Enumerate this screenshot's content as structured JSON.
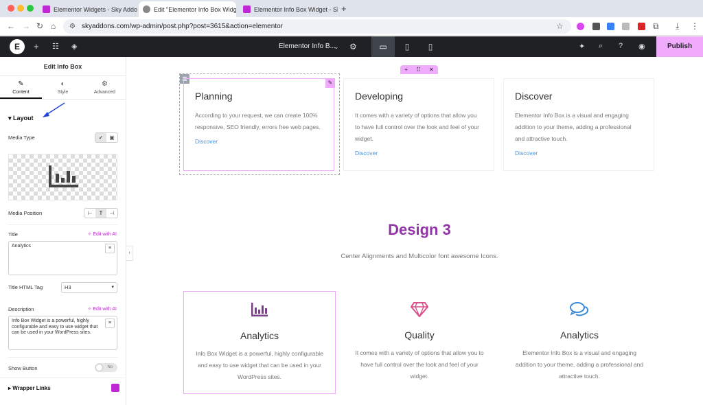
{
  "browser": {
    "tabs": [
      {
        "title": "Elementor Widgets - Sky Addons",
        "active": false
      },
      {
        "title": "Edit \"Elementor Info Box Widget\"",
        "active": true
      },
      {
        "title": "Elementor Info Box Widget - Sky",
        "active": false
      }
    ],
    "new_tab": "+",
    "url": "skyaddons.com/wp-admin/post.php?post=3615&action=elementor"
  },
  "editor_bar": {
    "page_title": "Elementor Info B...",
    "publish_label": "Publish"
  },
  "panel": {
    "title": "Edit Info Box",
    "tabs": [
      {
        "label": "Content",
        "icon": "pencil-icon",
        "glyph": "✎",
        "active": true
      },
      {
        "label": "Style",
        "icon": "half-circle-icon",
        "glyph": "◐",
        "active": false
      },
      {
        "label": "Advanced",
        "icon": "gear-icon",
        "glyph": "⚙",
        "active": false
      }
    ],
    "layout_heading": "Layout",
    "media_type_label": "Media Type",
    "media_position_label": "Media Position",
    "title_label": "Title",
    "edit_ai": "Edit with AI",
    "title_value": "Analytics",
    "title_tag_label": "Title HTML Tag",
    "title_tag_value": "H3",
    "description_label": "Description",
    "description_value": "Info Box Widget is a powerful, highly configurable and easy to use widget that can be used in your WordPress sites.",
    "show_button_label": "Show Button",
    "show_button_state": "No",
    "wrapper_links_heading": "Wrapper Links"
  },
  "canvas": {
    "cards_row1": [
      {
        "title": "Planning",
        "text": "According to your request, we can create 100% responsive, SEO friendly, errors free web pages.",
        "link": "Discover"
      },
      {
        "title": "Developing",
        "text": "It comes with a variety of options that allow you to have full control over the look and feel of your widget.",
        "link": "Discover"
      },
      {
        "title": "Discover",
        "text": "Elementor Info Box is a visual and engaging addition to your theme, adding a professional and attractive touch.",
        "link": "Discover"
      }
    ],
    "design_title": "Design 3",
    "design_subtitle": "Center Alignments and Multicolor font awesome Icons.",
    "cards_row2": [
      {
        "title": "Analytics",
        "text": "Info Box Widget is a powerful, highly configurable and easy to use widget that can be used in your WordPress sites.",
        "icon": "bar-chart-icon",
        "color": "#7b3f8c"
      },
      {
        "title": "Quality",
        "text": "It comes with a variety of options that allow you to have full control over the look and feel of your widget.",
        "icon": "diamond-icon",
        "color": "#d94f8a"
      },
      {
        "title": "Analytics",
        "text": "Elementor Info Box is a visual and engaging addition to your theme, adding a professional and attractive touch.",
        "icon": "comments-icon",
        "color": "#3b8ad9"
      }
    ]
  },
  "colors": {
    "accent": "#f0abfc",
    "brand_title": "#9333a8",
    "link": "#4a90d9"
  }
}
